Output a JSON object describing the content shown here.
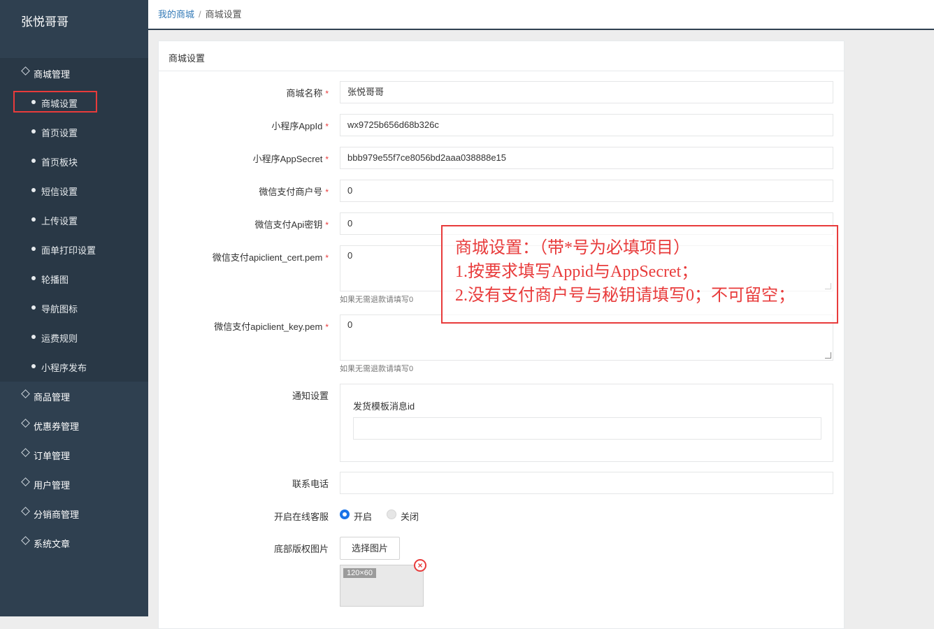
{
  "app": {
    "logo": "张悦哥哥"
  },
  "breadcrumb": {
    "home": "我的商城",
    "separator": "/",
    "current": "商城设置"
  },
  "sidebar": {
    "groups": [
      {
        "label": "商城管理",
        "expanded": true
      },
      {
        "label": "商品管理"
      },
      {
        "label": "优惠券管理"
      },
      {
        "label": "订单管理"
      },
      {
        "label": "用户管理"
      },
      {
        "label": "分销商管理"
      },
      {
        "label": "系统文章"
      }
    ],
    "subitems": [
      {
        "label": "商城设置",
        "active": true
      },
      {
        "label": "首页设置"
      },
      {
        "label": "首页板块"
      },
      {
        "label": "短信设置"
      },
      {
        "label": "上传设置"
      },
      {
        "label": "面单打印设置"
      },
      {
        "label": "轮播图"
      },
      {
        "label": "导航图标"
      },
      {
        "label": "运费规则"
      },
      {
        "label": "小程序发布"
      }
    ]
  },
  "panel": {
    "title": "商城设置"
  },
  "form": {
    "required_mark": "*",
    "fields": [
      {
        "label": "商城名称",
        "value": "张悦哥哥"
      },
      {
        "label": "小程序AppId",
        "value": "wx9725b656d68b326c"
      },
      {
        "label": "小程序AppSecret",
        "value": "bbb979e55f7ce8056bd2aaa038888e15"
      },
      {
        "label": "微信支付商户号",
        "value": "0"
      },
      {
        "label": "微信支付Api密钥",
        "value": "0"
      },
      {
        "label": "微信支付apiclient_cert.pem",
        "value": "0",
        "hint": "如果无需退款请填写0"
      },
      {
        "label": "微信支付apiclient_key.pem",
        "value": "0",
        "hint": "如果无需退款请填写0"
      }
    ],
    "notify": {
      "label": "通知设置",
      "sub_label": "发货模板消息id",
      "value": ""
    },
    "phone": {
      "label": "联系电话",
      "value": ""
    },
    "service": {
      "label": "开启在线客服",
      "on_label": "开启",
      "off_label": "关闭",
      "selected": "开启"
    },
    "footer_image": {
      "label": "底部版权图片",
      "button": "选择图片",
      "placeholder": "120×60",
      "remove": "×"
    }
  },
  "annotation": {
    "line1": "商城设置：（带*号为必填项目）",
    "line2": "1.按要求填写Appid与AppSecret；",
    "line3": "2.没有支付商户号与秘钥请填写0；不可留空；"
  },
  "colors": {
    "sidebar": "#2f4050",
    "sidebar_sub": "#293846",
    "accent_red": "#e83b3b",
    "link": "#337ab7",
    "radio_on": "#1a73e8"
  }
}
